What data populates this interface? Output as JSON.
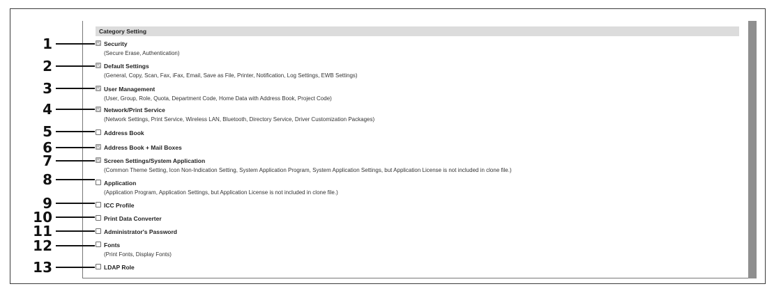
{
  "header": {
    "title": "Category Setting"
  },
  "rows": [
    {
      "number": "1",
      "label": "Security",
      "desc": "(Secure Erase, Authentication)",
      "checked": true
    },
    {
      "number": "2",
      "label": "Default Settings",
      "desc": "(General, Copy, Scan, Fax, iFax, Email, Save as File, Printer, Notification, Log Settings, EWB Settings)",
      "checked": true
    },
    {
      "number": "3",
      "label": "User Management",
      "desc": "(User, Group, Role, Quota, Department Code, Home Data with Address Book, Project Code)",
      "checked": true
    },
    {
      "number": "4",
      "label": "Network/Print Service",
      "desc": "(Network Settings, Print Service, Wireless LAN, Bluetooth, Directory Service, Driver Customization Packages)",
      "checked": true
    },
    {
      "number": "5",
      "label": "Address Book",
      "desc": "",
      "checked": false
    },
    {
      "number": "6",
      "label": "Address Book + Mail Boxes",
      "desc": "",
      "checked": true
    },
    {
      "number": "7",
      "label": "Screen Settings/System Application",
      "desc": "(Common Theme Setting, Icon Non-Indication Setting, System Application Program, System Application Settings, but Application License is not included in clone file.)",
      "checked": true
    },
    {
      "number": "8",
      "label": "Application",
      "desc": "(Application Program, Application Settings, but Application License is not included in clone file.)",
      "checked": false
    },
    {
      "number": "9",
      "label": "ICC Profile",
      "desc": "",
      "checked": false
    },
    {
      "number": "10",
      "label": "Print Data Converter",
      "desc": "",
      "checked": false
    },
    {
      "number": "11",
      "label": "Administrator's Password",
      "desc": "",
      "checked": false
    },
    {
      "number": "12",
      "label": "Fonts",
      "desc": "(Print Fonts, Display Fonts)",
      "checked": false
    },
    {
      "number": "13",
      "label": "LDAP Role",
      "desc": "",
      "checked": false
    }
  ]
}
